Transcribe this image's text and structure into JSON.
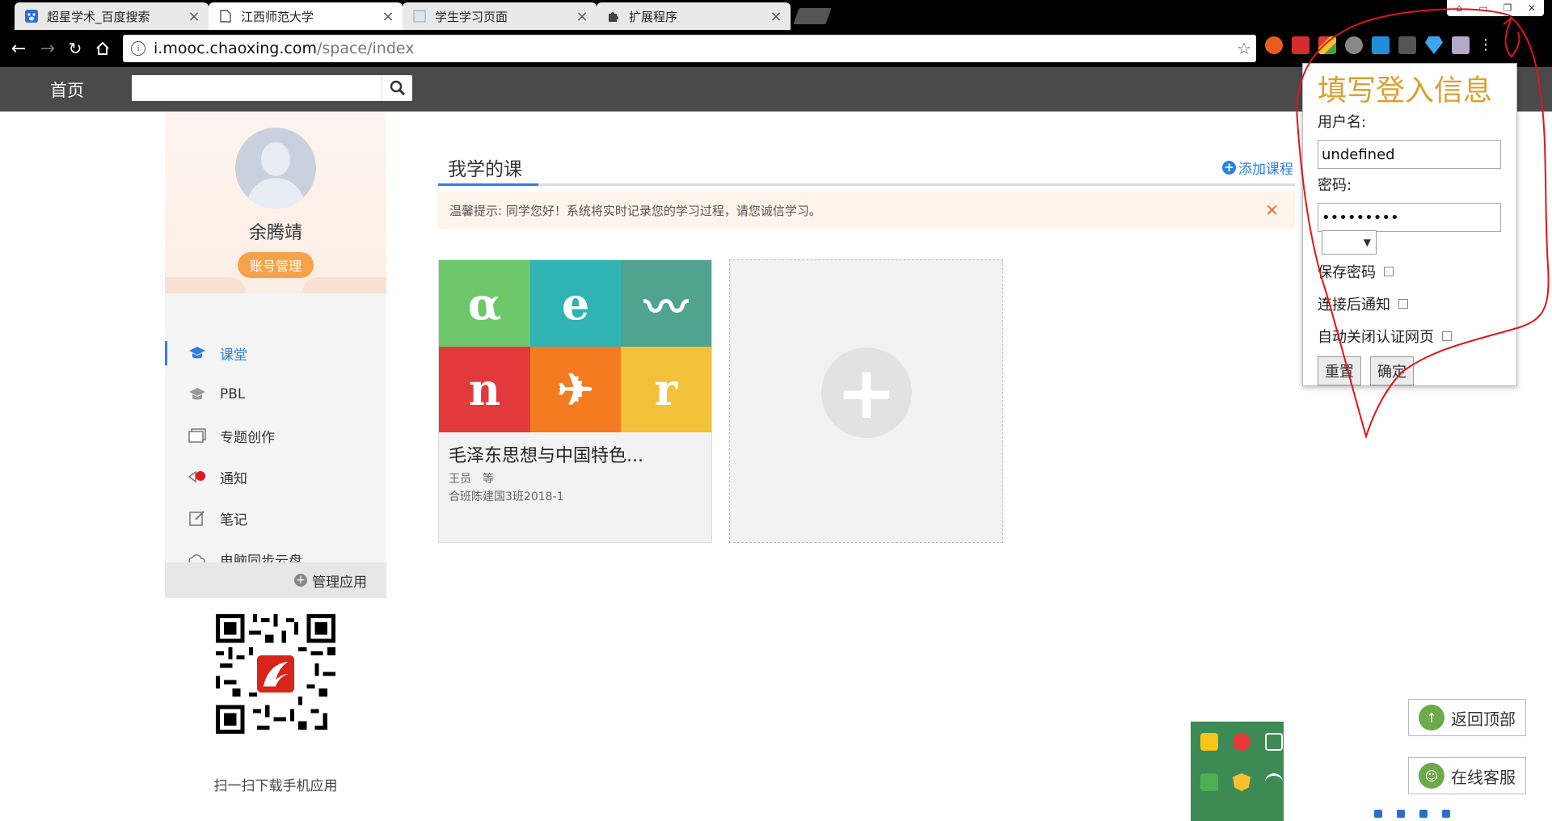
{
  "browser": {
    "tabs": [
      {
        "title": "超星学术_百度搜索",
        "icon": "baidu-paw-icon",
        "active": false
      },
      {
        "title": "江西师范大学",
        "icon": "page-icon",
        "active": true
      },
      {
        "title": "学生学习页面",
        "icon": "blank-page-icon",
        "active": false
      },
      {
        "title": "扩展程序",
        "icon": "puzzle-icon",
        "active": false
      }
    ],
    "url_host": "i.mooc.chaoxing.com",
    "url_path": "/space/index"
  },
  "header": {
    "home": "首页",
    "search_placeholder": ""
  },
  "sidebar": {
    "user_name": "余腾靖",
    "account_button": "账号管理",
    "nav": [
      {
        "label": "课堂",
        "icon": "classroom-icon",
        "active": true
      },
      {
        "label": "PBL",
        "icon": "pbl-icon",
        "active": false
      },
      {
        "label": "专题创作",
        "icon": "topic-icon",
        "active": false
      },
      {
        "label": "通知",
        "icon": "notification-icon",
        "active": false
      },
      {
        "label": "笔记",
        "icon": "note-icon",
        "active": false
      },
      {
        "label": "电脑同步云盘",
        "icon": "cloud-icon",
        "active": false
      }
    ],
    "manage_apps": "管理应用",
    "qr_caption": "扫一扫下载手机应用"
  },
  "main": {
    "title": "我学的课",
    "add_course": "添加课程",
    "notice": "温馨提示: 同学您好！系统将实时记录您的学习过程，请您诚信学习。",
    "course": {
      "name": "毛泽东思想与中国特色...",
      "teacher": "王员　等",
      "class": "合班陈建国3班2018-1",
      "tiles": [
        {
          "glyph": "α",
          "color": "#6cc86a"
        },
        {
          "glyph": "e",
          "color": "#2fb3b3"
        },
        {
          "glyph": "〰",
          "color": "#4fa38f"
        },
        {
          "glyph": "n",
          "color": "#e23a3a"
        },
        {
          "glyph": "✈",
          "color": "#f47b20"
        },
        {
          "glyph": "r",
          "color": "#f3c23b"
        }
      ]
    }
  },
  "popup": {
    "title": "填写登入信息",
    "username_label": "用户名:",
    "username_value": "undefined",
    "password_label": "密码:",
    "password_value": "•••••••••",
    "select_value": "",
    "checks": [
      "保存密码",
      "连接后通知",
      "自动关闭认证网页"
    ],
    "reset": "重置",
    "confirm": "确定"
  },
  "floating": {
    "back_to_top": "返回顶部",
    "online_service": "在线客服"
  },
  "colors": {
    "accent": "#2b7fe0",
    "header_bg": "#4a4a4a",
    "popup_title": "#d9a02f",
    "annotation": "#e0151b"
  }
}
